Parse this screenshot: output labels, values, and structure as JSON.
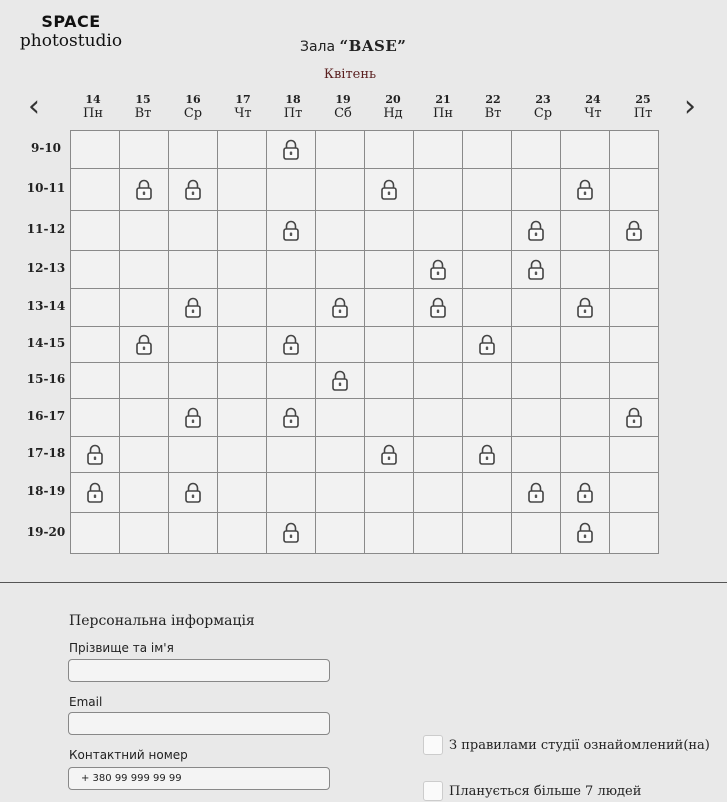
{
  "brand": {
    "top": "SPACE",
    "bottom": "photostudio"
  },
  "hall": {
    "prefix": "Зала ",
    "name": "“BASE”"
  },
  "calendar": {
    "month": "Квітень",
    "prev_icon": "chevron-left-icon",
    "next_icon": "chevron-right-icon",
    "days": [
      {
        "num": "14",
        "name": "Пн"
      },
      {
        "num": "15",
        "name": "Вт"
      },
      {
        "num": "16",
        "name": "Ср"
      },
      {
        "num": "17",
        "name": "Чт"
      },
      {
        "num": "18",
        "name": "Пт"
      },
      {
        "num": "19",
        "name": "Сб"
      },
      {
        "num": "20",
        "name": "Нд"
      },
      {
        "num": "21",
        "name": "Пн"
      },
      {
        "num": "22",
        "name": "Вт"
      },
      {
        "num": "23",
        "name": "Ср"
      },
      {
        "num": "24",
        "name": "Чт"
      },
      {
        "num": "25",
        "name": "Пт"
      }
    ],
    "hours": [
      "9-10",
      "10-11",
      "11-12",
      "12-13",
      "13-14",
      "14-15",
      "15-16",
      "16-17",
      "17-18",
      "18-19",
      "19-20"
    ],
    "locked": [
      [
        0,
        4
      ],
      [
        1,
        1
      ],
      [
        1,
        2
      ],
      [
        1,
        6
      ],
      [
        1,
        10
      ],
      [
        2,
        4
      ],
      [
        2,
        9
      ],
      [
        2,
        11
      ],
      [
        3,
        7
      ],
      [
        3,
        9
      ],
      [
        4,
        2
      ],
      [
        4,
        5
      ],
      [
        4,
        7
      ],
      [
        4,
        10
      ],
      [
        5,
        1
      ],
      [
        5,
        4
      ],
      [
        5,
        8
      ],
      [
        6,
        5
      ],
      [
        7,
        2
      ],
      [
        7,
        4
      ],
      [
        7,
        11
      ],
      [
        8,
        0
      ],
      [
        8,
        6
      ],
      [
        8,
        8
      ],
      [
        9,
        0
      ],
      [
        9,
        2
      ],
      [
        9,
        9
      ],
      [
        9,
        10
      ],
      [
        10,
        4
      ],
      [
        10,
        10
      ]
    ],
    "lock_icon": "lock-icon"
  },
  "form": {
    "title": "Персональна інформація",
    "name_label": "Прізвище та ім'я",
    "name_value": "",
    "email_label": "Email",
    "email_value": "",
    "phone_label": "Контактний номер",
    "phone_value": "+ 380 99 999 99 99",
    "rules_check": "З правилами студії ознайомлений(на)",
    "people_check": "Планується більше 7 людей"
  }
}
